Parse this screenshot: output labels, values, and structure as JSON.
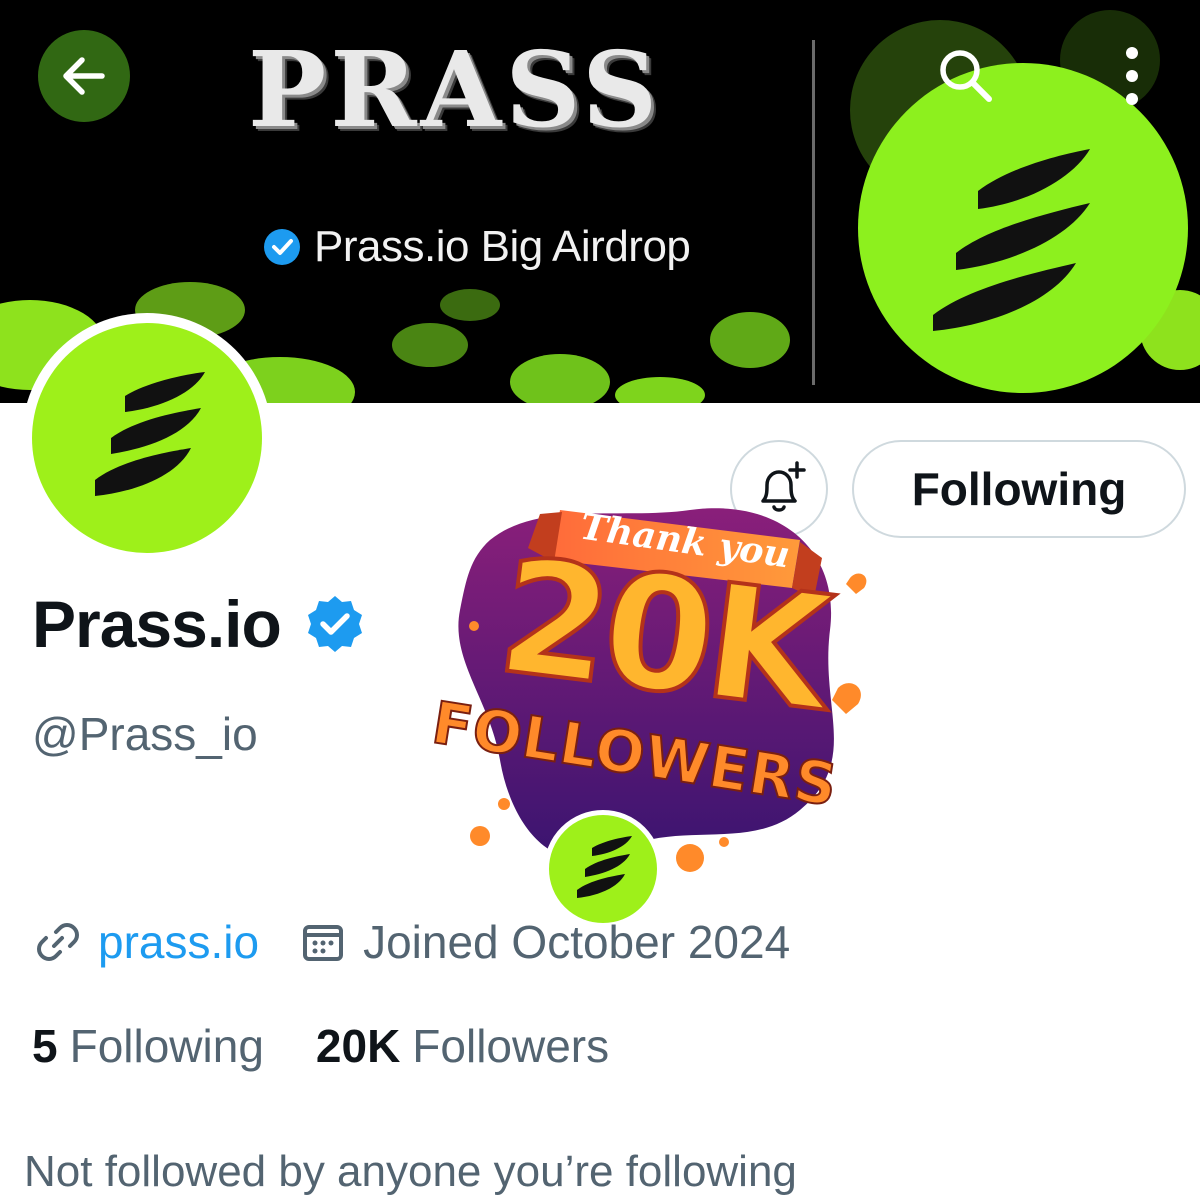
{
  "banner": {
    "title": "PRASS",
    "subtitle": "Prass.io Big Airdrop",
    "back_icon": "arrow-left-icon",
    "search_icon": "search-icon",
    "more_icon": "more-vertical-icon"
  },
  "profile": {
    "name": "Prass.io",
    "handle": "@Prass_io",
    "website": "prass.io",
    "joined": "Joined October 2024",
    "following_count": "5",
    "following_label": "Following",
    "followers_count": "20K",
    "followers_label": "Followers",
    "mutuals_text": "Not followed by anyone you’re following"
  },
  "actions": {
    "follow_state_label": "Following",
    "bell_icon": "bell-plus-icon"
  },
  "sticker": {
    "ribbon": "Thank you",
    "big": "20K",
    "sub": "FOLLOWERS"
  },
  "colors": {
    "accent_green": "#9ef01a",
    "link_blue": "#1d9bf0",
    "verified_blue": "#1d9bf0",
    "muted_text": "#536471"
  }
}
